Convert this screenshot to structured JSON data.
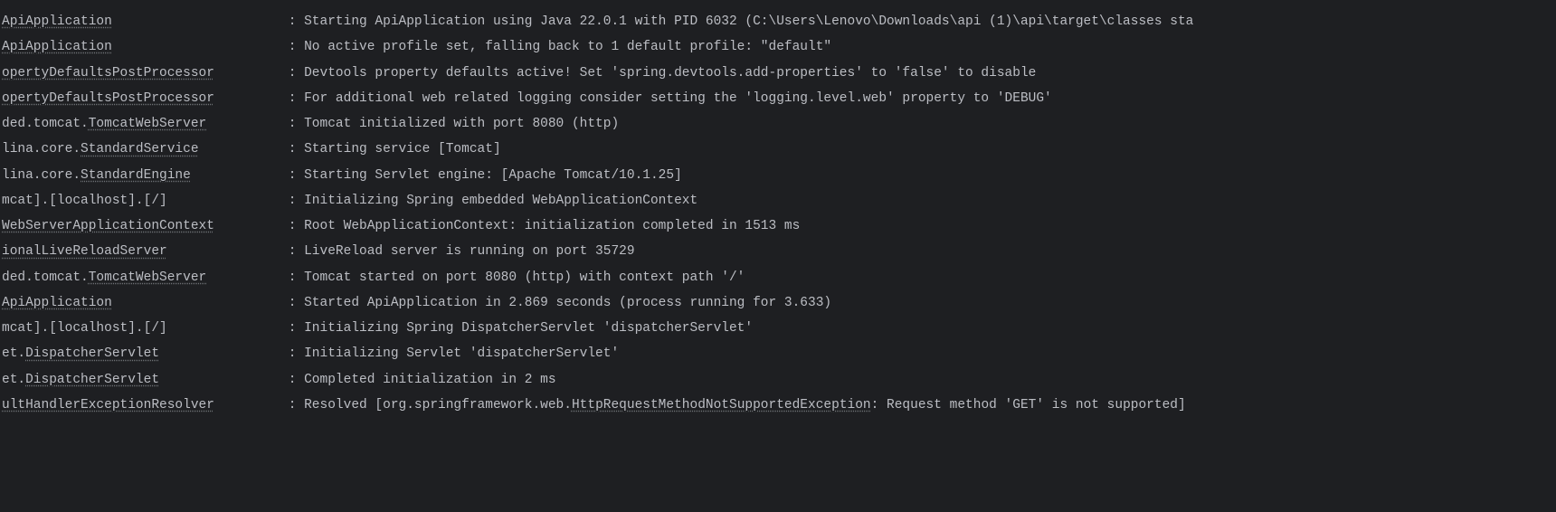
{
  "log_lines": [
    {
      "logger": "ApiApplication",
      "logger_prefix": "",
      "logger_main": "ApiApplication",
      "separator": " : ",
      "message": "Starting ApiApplication using Java 22.0.1 with PID 6032 (C:\\Users\\Lenovo\\Downloads\\api (1)\\api\\target\\classes sta"
    },
    {
      "logger": "ApiApplication",
      "logger_prefix": "",
      "logger_main": "ApiApplication",
      "separator": " : ",
      "message": "No active profile set, falling back to 1 default profile: \"default\""
    },
    {
      "logger": "opertyDefaultsPostProcessor",
      "logger_prefix": "",
      "logger_main": "opertyDefaultsPostProcessor",
      "separator": " : ",
      "message": "Devtools property defaults active! Set 'spring.devtools.add-properties' to 'false' to disable"
    },
    {
      "logger": "opertyDefaultsPostProcessor",
      "logger_prefix": "",
      "logger_main": "opertyDefaultsPostProcessor",
      "separator": " : ",
      "message": "For additional web related logging consider setting the 'logging.level.web' property to 'DEBUG'"
    },
    {
      "logger": "ded.tomcat.TomcatWebServer",
      "logger_prefix": "ded.tomcat.",
      "logger_main": "TomcatWebServer",
      "separator": " : ",
      "message": "Tomcat initialized with port 8080 (http)"
    },
    {
      "logger": "lina.core.StandardService",
      "logger_prefix": "lina.core.",
      "logger_main": "StandardService",
      "separator": " : ",
      "message": "Starting service [Tomcat]"
    },
    {
      "logger": "lina.core.StandardEngine",
      "logger_prefix": "lina.core.",
      "logger_main": "StandardEngine",
      "separator": " : ",
      "message": "Starting Servlet engine: [Apache Tomcat/10.1.25]"
    },
    {
      "logger": "mcat].[localhost].[/]",
      "logger_prefix": "mcat].[localhost].[/]",
      "logger_main": "",
      "separator": " : ",
      "message": "Initializing Spring embedded WebApplicationContext"
    },
    {
      "logger": "WebServerApplicationContext",
      "logger_prefix": "",
      "logger_main": "WebServerApplicationContext",
      "separator": " : ",
      "message": "Root WebApplicationContext: initialization completed in 1513 ms"
    },
    {
      "logger": "ionalLiveReloadServer",
      "logger_prefix": "",
      "logger_main": "ionalLiveReloadServer",
      "separator": " : ",
      "message": "LiveReload server is running on port 35729"
    },
    {
      "logger": "ded.tomcat.TomcatWebServer",
      "logger_prefix": "ded.tomcat.",
      "logger_main": "TomcatWebServer",
      "separator": " : ",
      "message": "Tomcat started on port 8080 (http) with context path '/'"
    },
    {
      "logger": "ApiApplication",
      "logger_prefix": "",
      "logger_main": "ApiApplication",
      "separator": " : ",
      "message": "Started ApiApplication in 2.869 seconds (process running for 3.633)"
    },
    {
      "logger": "mcat].[localhost].[/]",
      "logger_prefix": "mcat].[localhost].[/]",
      "logger_main": "",
      "separator": " : ",
      "message": "Initializing Spring DispatcherServlet 'dispatcherServlet'"
    },
    {
      "logger": "et.DispatcherServlet",
      "logger_prefix": "et.",
      "logger_main": "DispatcherServlet",
      "separator": " : ",
      "message": "Initializing Servlet 'dispatcherServlet'"
    },
    {
      "logger": "et.DispatcherServlet",
      "logger_prefix": "et.",
      "logger_main": "DispatcherServlet",
      "separator": " : ",
      "message": "Completed initialization in 2 ms"
    },
    {
      "logger": "ultHandlerExceptionResolver",
      "logger_prefix": "",
      "logger_main": "ultHandlerExceptionResolver",
      "separator": " : ",
      "message_prefix": "Resolved [org.springframework.web.",
      "exception_class": "HttpRequestMethodNotSupportedException",
      "message_suffix": ": Request method 'GET' is not supported]"
    }
  ]
}
